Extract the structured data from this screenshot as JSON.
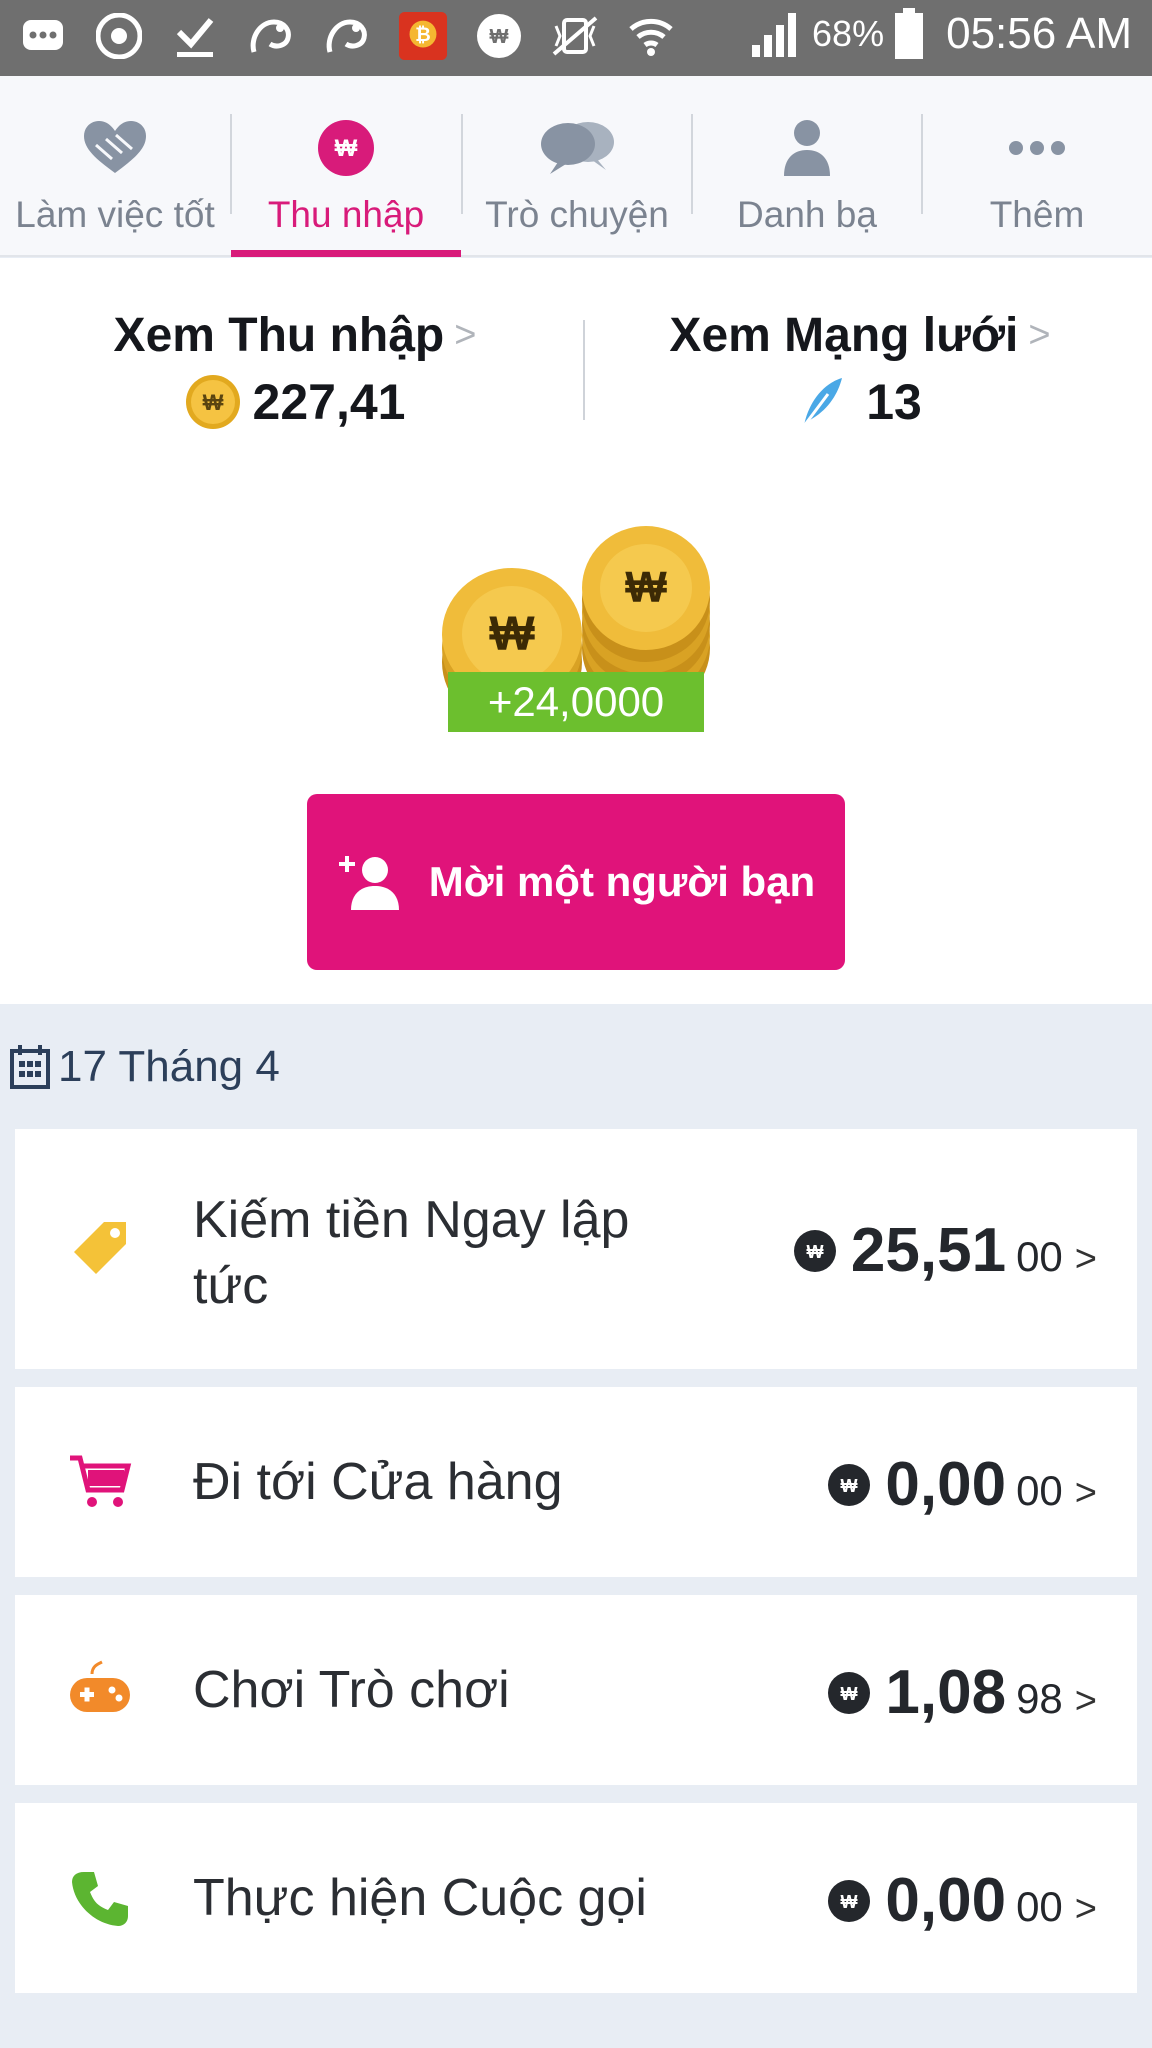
{
  "status_bar": {
    "battery": "68%",
    "time": "05:56 AM"
  },
  "tabs": [
    {
      "label": "Làm việc tốt",
      "icon": "heart-hands-icon"
    },
    {
      "label": "Thu nhập",
      "icon": "wow-coin-icon",
      "active": true
    },
    {
      "label": "Trò chuyện",
      "icon": "chat-bubbles-icon"
    },
    {
      "label": "Danh bạ",
      "icon": "person-icon"
    },
    {
      "label": "Thêm",
      "icon": "more-dots-icon"
    }
  ],
  "stats": {
    "earnings": {
      "title": "Xem Thu nhập",
      "value": "227,41"
    },
    "network": {
      "title": "Xem Mạng lưới",
      "value": "13"
    }
  },
  "reward": "+24,0000",
  "invite_button": "Mời một người bạn",
  "date": "17 Tháng 4",
  "activities": [
    {
      "label": "Kiếm tiền Ngay lập tức",
      "amount": "25,51",
      "decimals": "00",
      "icon": "tag-icon",
      "color": "#f4c238"
    },
    {
      "label": "Đi tới Cửa hàng",
      "amount": "0,00",
      "decimals": "00",
      "icon": "shopping-cart-icon",
      "color": "#e0137a"
    },
    {
      "label": "Chơi Trò chơi",
      "amount": "1,08",
      "decimals": "98",
      "icon": "gamepad-icon",
      "color": "#f28a2a"
    },
    {
      "label": "Thực hiện Cuộc gọi",
      "amount": "0,00",
      "decimals": "00",
      "icon": "phone-icon",
      "color": "#5cb531"
    }
  ],
  "colors": {
    "brand": "#e0137a",
    "reward_green": "#6cbf2e",
    "status_bar": "#6f6f6f"
  }
}
